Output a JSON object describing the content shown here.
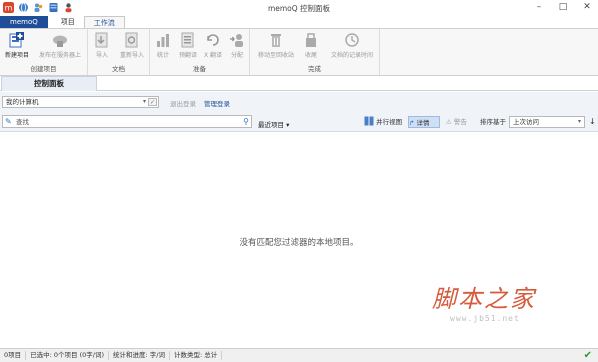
{
  "window": {
    "title": "memoQ 控制面板",
    "controls": [
      "–",
      "□",
      "✕"
    ],
    "quick_access_icons": [
      "memoq-logo-icon",
      "globe-icon",
      "users-icon",
      "database-icon",
      "person-icon"
    ]
  },
  "ribbon_tabs": [
    {
      "label": "memoQ"
    },
    {
      "label": "项目"
    },
    {
      "label": "工作流"
    }
  ],
  "ribbon": {
    "groups": [
      {
        "label": "创建项目",
        "buttons": [
          {
            "label": "新建项目",
            "icon": "new-project-icon",
            "enabled": true
          },
          {
            "label": "发布在服务器上",
            "icon": "publish-server-icon",
            "enabled": false
          }
        ]
      },
      {
        "label": "文档",
        "buttons": [
          {
            "label": "导入",
            "icon": "import-icon",
            "enabled": false
          },
          {
            "label": "重新导入",
            "icon": "reimport-icon",
            "enabled": false
          }
        ]
      },
      {
        "label": "准备",
        "buttons": [
          {
            "label": "统计",
            "icon": "statistics-icon",
            "enabled": false
          },
          {
            "label": "预翻译",
            "icon": "pretranslate-icon",
            "enabled": false
          },
          {
            "label": "X 翻译",
            "icon": "x-translate-icon",
            "enabled": false
          },
          {
            "label": "分配",
            "icon": "assign-icon",
            "enabled": false
          }
        ]
      },
      {
        "label": "完成",
        "buttons": [
          {
            "label": "移动至回收站",
            "icon": "trash-icon",
            "enabled": false
          },
          {
            "label": "收尾",
            "icon": "wrap-up-icon",
            "enabled": false
          },
          {
            "label": "文档的记录时间",
            "icon": "clock-icon",
            "enabled": false
          }
        ]
      }
    ]
  },
  "pane": {
    "tab_label": "控制面板"
  },
  "location": {
    "selected": "我的计算机",
    "login_label": "退出登录",
    "manage_login_label": "管理登录"
  },
  "filter": {
    "search_placeholder": "查找",
    "recent_label": "最近项目",
    "parallel_view_label": "并行视图",
    "details_label": "详情",
    "warnings_label": "警告",
    "sort_label": "排序基于",
    "sort_value": "上次访问"
  },
  "main": {
    "empty_message": "没有匹配您过滤器的本地项目。"
  },
  "watermark": {
    "big": "脚本之家",
    "small": "www.jb51.net"
  },
  "statusbar": {
    "segments": [
      "0项目",
      "已选中: 0个项目 (0字/词)",
      "统计和进度: 字/词",
      "计数类型: 总计"
    ]
  },
  "colors": {
    "accent": "#1f4e99",
    "ribbon_bg": "#f7f7f7",
    "bar_bg": "#f0f3f8",
    "watermark_red": "#d65a3c",
    "ok_green": "#2e9a2e"
  }
}
